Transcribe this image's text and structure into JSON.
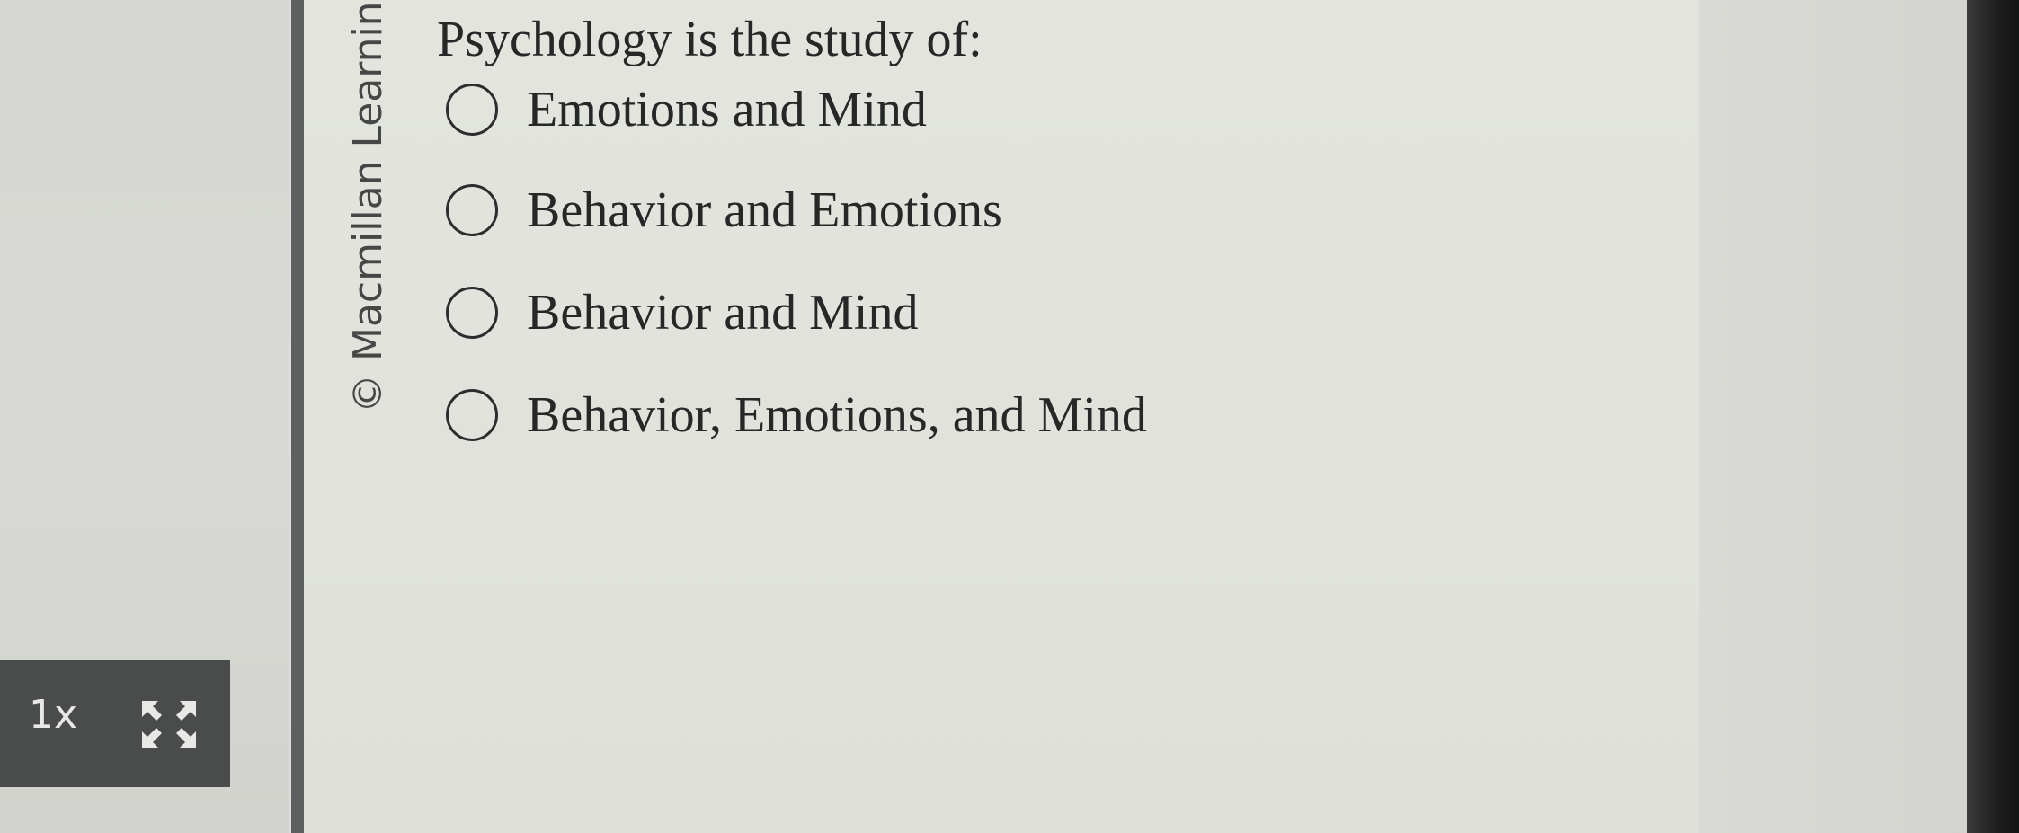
{
  "watermark": "© Macmillan Learnin",
  "question": {
    "text": "Psychology is the study of:"
  },
  "options": [
    {
      "label": "Emotions and Mind",
      "selected": false
    },
    {
      "label": "Behavior and Emotions",
      "selected": false
    },
    {
      "label": "Behavior and Mind",
      "selected": false
    },
    {
      "label": "Behavior, Emotions, and Mind",
      "selected": false
    }
  ],
  "player": {
    "speed_label": "1x",
    "fullscreen_icon": "expand-arrows-icon"
  },
  "colors": {
    "text": "#262828",
    "player_bg": "#4a4c4c",
    "divider": "#5e605f"
  }
}
